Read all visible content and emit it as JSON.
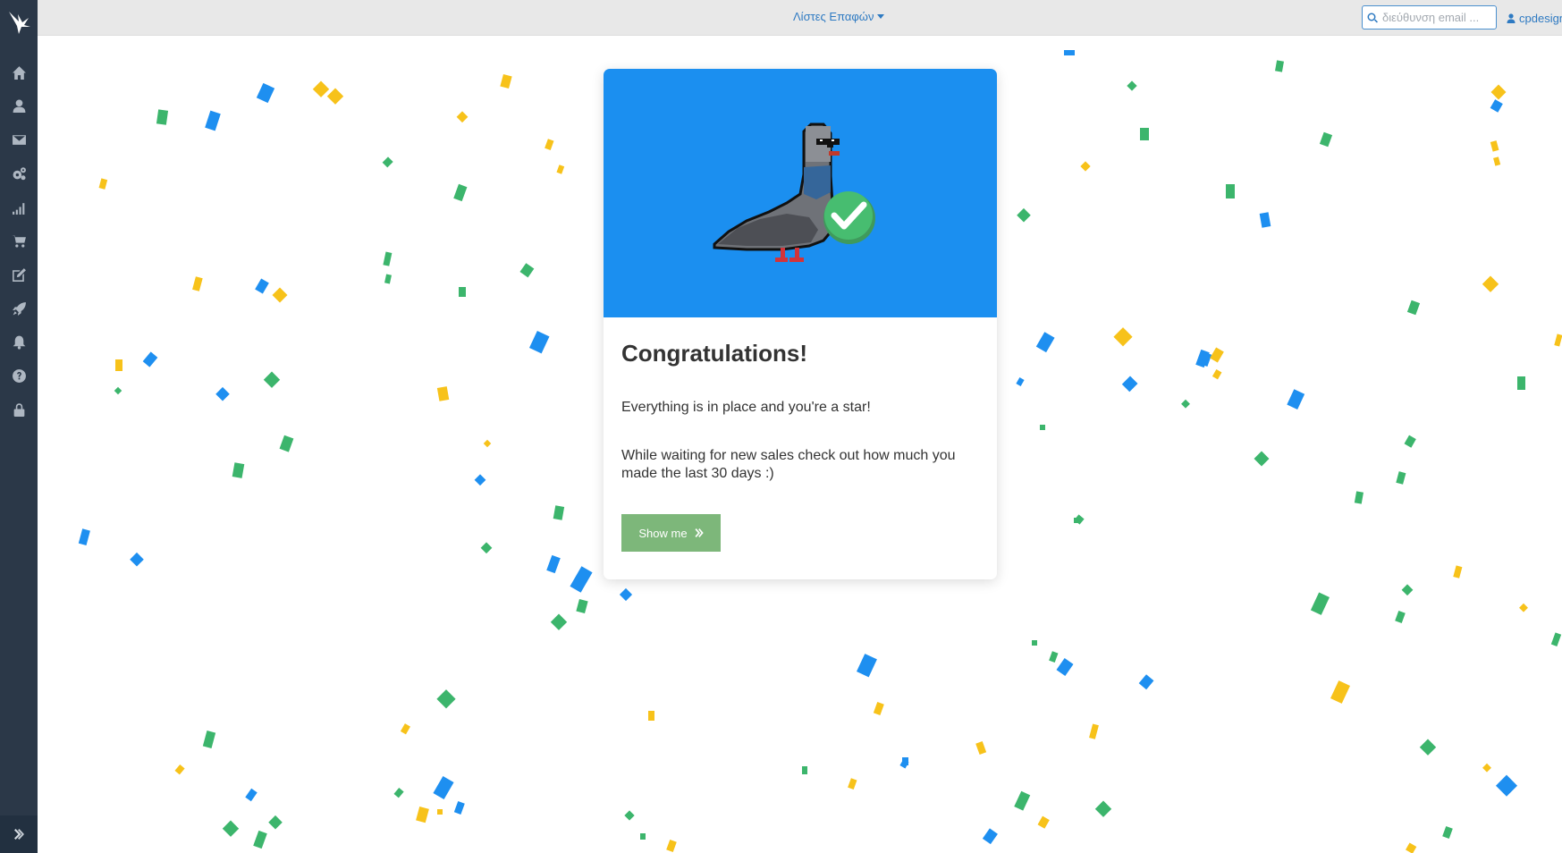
{
  "header": {
    "lists_menu_label": "Λίστες Επαφών",
    "search": {
      "placeholder": "διεύθυνση email ...",
      "value": ""
    },
    "username": "cpdesign"
  },
  "sidebar": {
    "items": [
      {
        "icon": "home-icon"
      },
      {
        "icon": "user-icon"
      },
      {
        "icon": "envelope-icon"
      },
      {
        "icon": "cogs-icon"
      },
      {
        "icon": "signal-bars-icon"
      },
      {
        "icon": "shopping-cart-icon"
      },
      {
        "icon": "edit-icon"
      },
      {
        "icon": "rocket-icon"
      },
      {
        "icon": "bell-icon"
      },
      {
        "icon": "question-circle-icon"
      },
      {
        "icon": "lock-icon"
      }
    ],
    "expand_icon": "double-chevron-right-icon"
  },
  "card": {
    "title": "Congratulations!",
    "text1": "Everything is in place and you're a star!",
    "text2": "While waiting for new sales check out how much you made the last 30 days :)",
    "button_label": "Show me"
  },
  "colors": {
    "sidebar": "#2b3848",
    "topbar": "#e8e8e8",
    "link": "#2e7ac2",
    "hero": "#1b8ff0",
    "button": "#7db77a",
    "confetti_blue": "#1e8ff0",
    "confetti_green": "#3cb56c",
    "confetti_yellow": "#f7c21a"
  }
}
